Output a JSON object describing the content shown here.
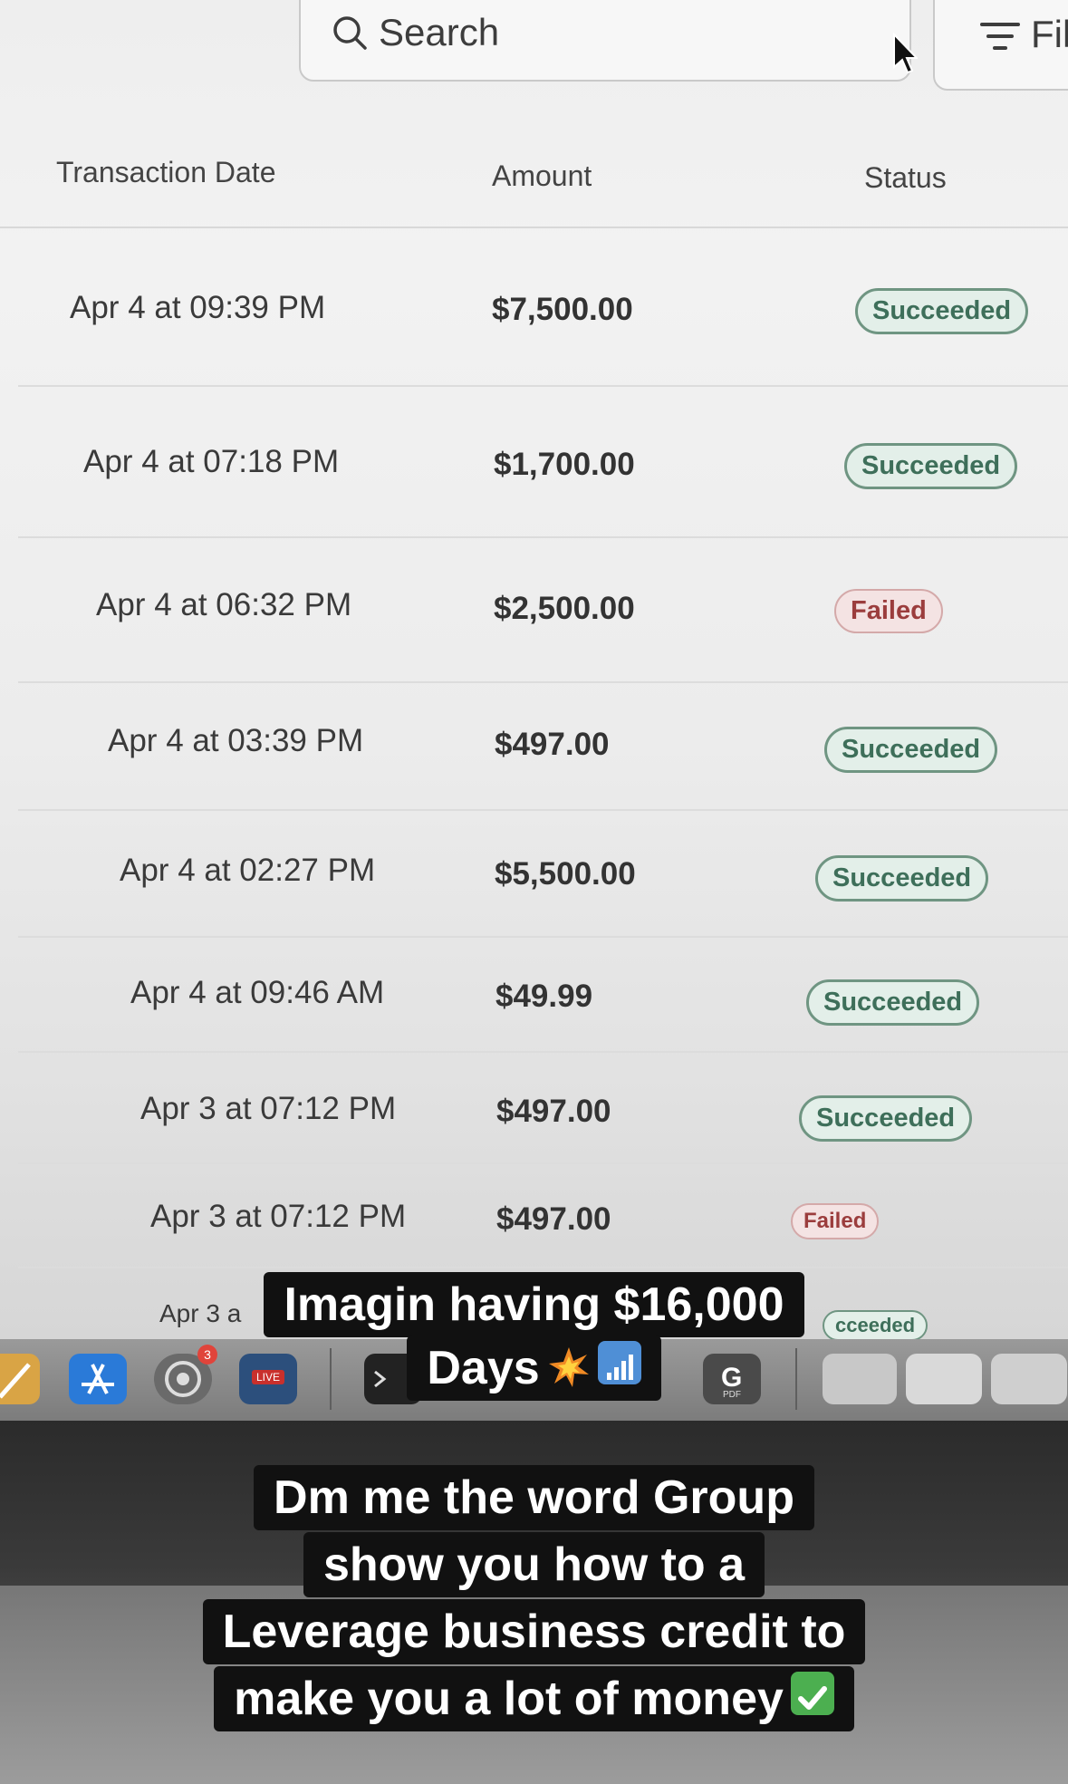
{
  "search": {
    "label": "Search"
  },
  "filter": {
    "label": "Fil"
  },
  "table": {
    "columns": {
      "date": "Transaction Date",
      "amount": "Amount",
      "status": "Status"
    },
    "rows": [
      {
        "date": "Apr 4 at 09:39 PM",
        "amount": "$7,500.00",
        "status": "Succeeded"
      },
      {
        "date": "Apr 4 at 07:18 PM",
        "amount": "$1,700.00",
        "status": "Succeeded"
      },
      {
        "date": "Apr 4 at 06:32 PM",
        "amount": "$2,500.00",
        "status": "Failed"
      },
      {
        "date": "Apr 4 at 03:39 PM",
        "amount": "$497.00",
        "status": "Succeeded"
      },
      {
        "date": "Apr 4 at 02:27 PM",
        "amount": "$5,500.00",
        "status": "Succeeded"
      },
      {
        "date": "Apr 4 at 09:46 AM",
        "amount": "$49.99",
        "status": "Succeeded"
      },
      {
        "date": "Apr 3 at 07:12 PM",
        "amount": "$497.00",
        "status": "Succeeded"
      },
      {
        "date": "Apr 3 at 07:12 PM",
        "amount": "$497.00",
        "status": "Failed"
      }
    ],
    "partial_row": {
      "date": "Apr 3 a",
      "status": "cceeded"
    }
  },
  "dock": {
    "icons": [
      "pencil-icon",
      "app-store-icon",
      "system-preferences-icon",
      "live-app-icon",
      "terminal-icon",
      "pdf-app-icon",
      "window-thumbnail-icon",
      "window-thumbnail-icon",
      "window-thumbnail-icon"
    ],
    "pdf_label": "PDF",
    "live_label": "LIVE",
    "badge_count": "3"
  },
  "captions": {
    "top": {
      "line1": "Imagin having $16,000",
      "line2": "Days",
      "emojis": [
        "collision-emoji",
        "signal-bars-emoji"
      ]
    },
    "bottom": {
      "line1": "Dm me the word Group",
      "line2": "show you how to a",
      "line3": "Leverage business credit to",
      "line4": "make you a lot of money",
      "emoji": "check-mark-emoji"
    }
  },
  "colors": {
    "success_bg": "#e3efe9",
    "success_border": "#6f9582",
    "success_text": "#3e6f5a",
    "failed_bg": "#f4e3e3",
    "failed_text": "#9b3d3d",
    "caption_bg": "#111111"
  }
}
